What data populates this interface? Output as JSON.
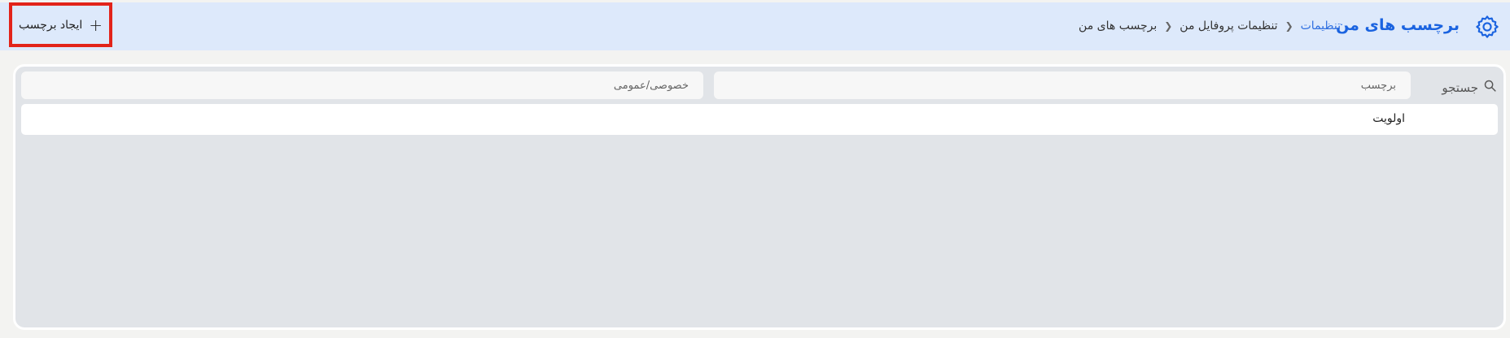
{
  "header": {
    "title": "برچسب های من",
    "breadcrumb": {
      "root": "تنظیمات",
      "middle": "تنظیمات پروفایل من",
      "current": "برچسب های من"
    },
    "create_button_label": "ایجاد برچسب",
    "icons": {
      "settings": "gear-icon",
      "plus": "plus-icon"
    },
    "accent_color": "#1a63e0",
    "highlight_color": "#e2231a"
  },
  "filters": {
    "search_label": "جستجو",
    "tag_placeholder": "برچسب",
    "privacy_placeholder": "خصوصی/عمومی"
  },
  "table": {
    "columns": [
      "اولویت"
    ]
  }
}
